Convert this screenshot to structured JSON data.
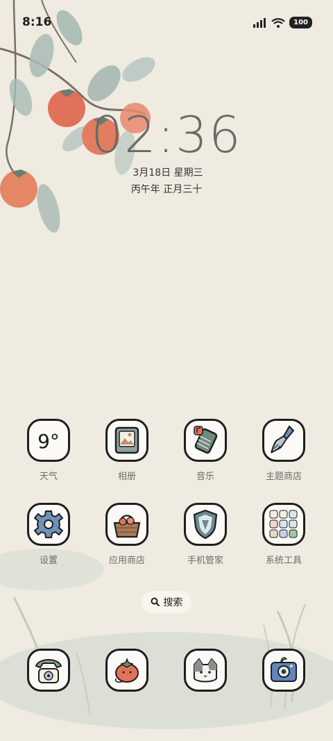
{
  "status_bar": {
    "time": "8:16",
    "battery": "100",
    "icons": [
      "signal-icon",
      "wifi-icon",
      "battery-icon"
    ]
  },
  "lock": {
    "clock": "02:36",
    "date": "3月18日 星期三",
    "lunar": "丙午年 正月三十"
  },
  "apps": {
    "weather": {
      "label": "天气",
      "temp": "9°"
    },
    "gallery": {
      "label": "相册"
    },
    "music": {
      "label": "音乐"
    },
    "themes": {
      "label": "主题商店"
    },
    "settings": {
      "label": "设置"
    },
    "app_store": {
      "label": "应用商店"
    },
    "phone_manager": {
      "label": "手机管家"
    },
    "system_tools": {
      "label": "系统工具"
    }
  },
  "search": {
    "label": "搜索"
  },
  "dock": [
    "phone-icon",
    "messages-icon",
    "contacts-icon",
    "camera-icon"
  ],
  "colors": {
    "background": "#efebe1",
    "icon_border": "#1e1e1e",
    "icon_fill": "#fbfaf6",
    "label": "#6d6d68",
    "persimmon": "#e0725a",
    "leaf": "#9fb3ad"
  }
}
